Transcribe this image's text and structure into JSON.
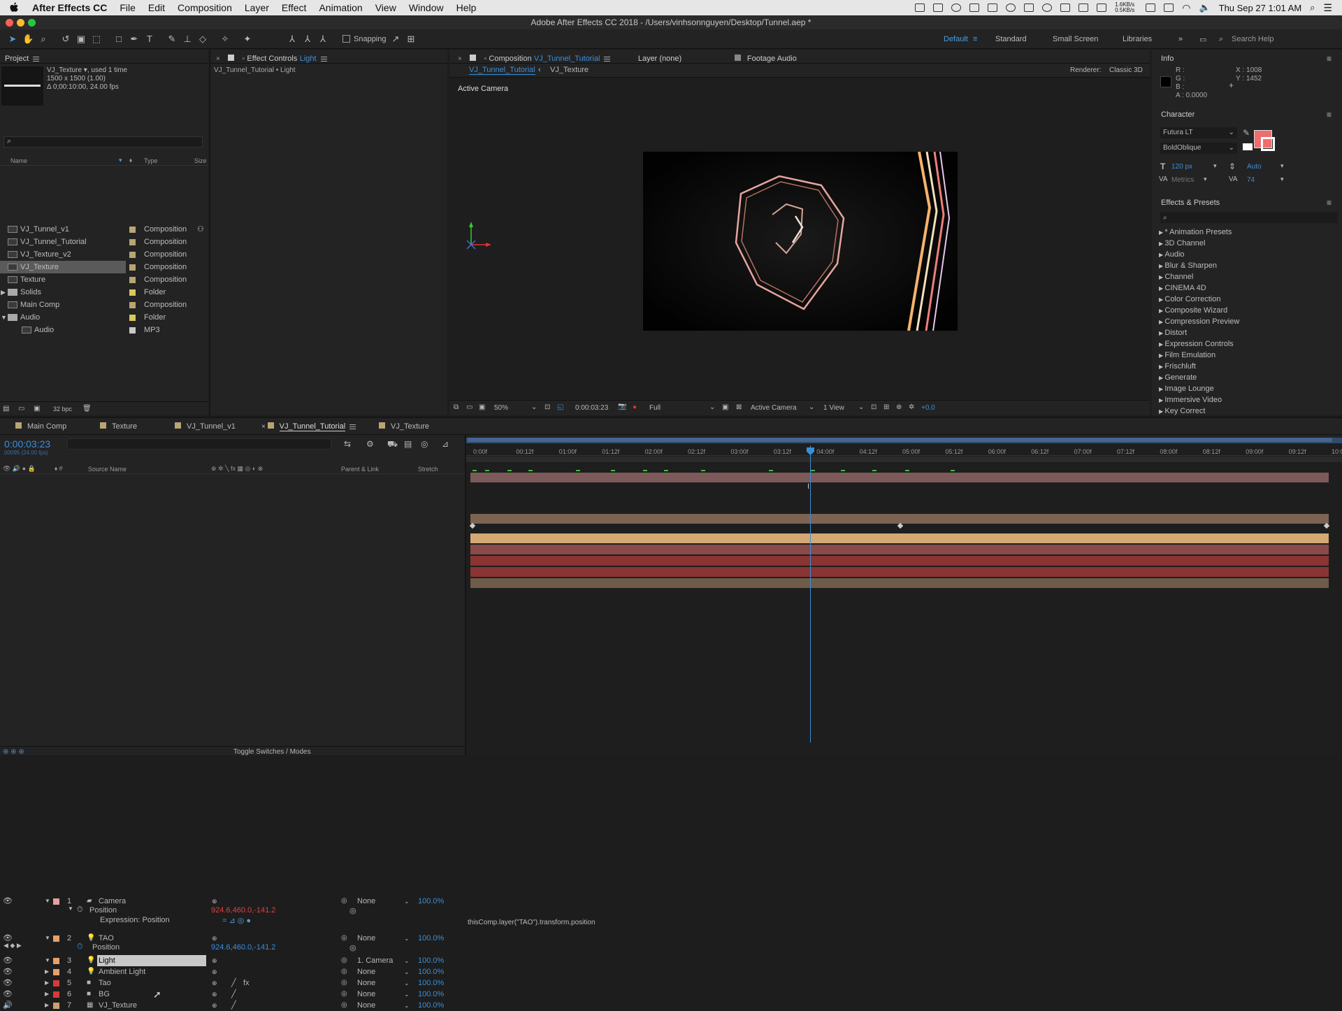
{
  "menubar": {
    "app": "After Effects CC",
    "items": [
      "File",
      "Edit",
      "Composition",
      "Layer",
      "Effect",
      "Animation",
      "View",
      "Window",
      "Help"
    ],
    "net": "1.6KB/s\n0.5KB/s",
    "clock": "Thu Sep 27  1:01 AM"
  },
  "window_title": "Adobe After Effects CC 2018 - /Users/vinhsonnguyen/Desktop/Tunnel.aep *",
  "toolbar": {
    "snapping": "Snapping",
    "workspaces": [
      "Default",
      "Standard",
      "Small Screen",
      "Libraries"
    ],
    "search": "Search Help"
  },
  "project": {
    "tab": "Project",
    "selected_name": "VJ_Texture",
    "used": ", used 1 time",
    "dims": "1500 x 1500 (1.00)",
    "duration": "Δ 0;00:10:00, 24.00 fps",
    "col_name": "Name",
    "col_type": "Type",
    "col_size": "Size",
    "bpc": "32 bpc",
    "items": [
      {
        "name": "VJ_Tunnel_v1",
        "type": "Composition",
        "color": "#b9a473"
      },
      {
        "name": "VJ_Tunnel_Tutorial",
        "type": "Composition",
        "color": "#b9a473"
      },
      {
        "name": "VJ_Texture_v2",
        "type": "Composition",
        "color": "#b9a473"
      },
      {
        "name": "VJ_Texture",
        "type": "Composition",
        "color": "#b9a473"
      },
      {
        "name": "Texture",
        "type": "Composition",
        "color": "#b9a473"
      },
      {
        "name": "Solids",
        "type": "Folder",
        "color": "#d9c85a"
      },
      {
        "name": "Main Comp",
        "type": "Composition",
        "color": "#b9a473"
      },
      {
        "name": "Audio",
        "type": "Folder",
        "color": "#d9c85a"
      },
      {
        "name": "Audio",
        "type": "MP3",
        "color": "#c9c9c9"
      }
    ]
  },
  "effect_controls": {
    "tab": "Effect Controls",
    "layer": "Light",
    "sub": "VJ_Tunnel_Tutorial • Light"
  },
  "comp": {
    "tab_prefix": "Composition",
    "tab_name": "VJ_Tunnel_Tutorial",
    "layer_tab": "Layer (none)",
    "footage_tab": "Footage Audio",
    "crumb1": "VJ_Tunnel_Tutorial",
    "crumb2": "VJ_Texture",
    "renderer_label": "Renderer:",
    "renderer": "Classic 3D",
    "view_label": "Active Camera",
    "zoom": "50%",
    "timecode": "0:00:03:23",
    "quality": "Full",
    "camera": "Active Camera",
    "views": "1 View",
    "exposure": "+0.0"
  },
  "info": {
    "tab": "Info",
    "r": "R :",
    "g": "G :",
    "b": "B :",
    "a": "A :  0.0000",
    "x": "X : 1008",
    "y": "Y : 1452"
  },
  "character": {
    "tab": "Character",
    "font": "Futura LT",
    "style": "BoldOblique",
    "size": "120 px",
    "leading": "Auto",
    "kerning": "Metrics",
    "tracking": "74"
  },
  "effects": {
    "tab": "Effects & Presets",
    "items": [
      "* Animation Presets",
      "3D Channel",
      "Audio",
      "Blur & Sharpen",
      "Channel",
      "CINEMA 4D",
      "Color Correction",
      "Composite Wizard",
      "Compression Preview",
      "Distort",
      "Expression Controls",
      "Film Emulation",
      "Frischluft",
      "Generate",
      "Image Lounge",
      "Immersive Video",
      "Key Correct"
    ]
  },
  "timeline": {
    "tabs": [
      "Main Comp",
      "Texture",
      "VJ_Tunnel_v1",
      "VJ_Tunnel_Tutorial",
      "VJ_Texture"
    ],
    "timecode": "0:00:03:23",
    "frames": "00095 (24.00 fps)",
    "col_source": "Source Name",
    "col_parent": "Parent & Link",
    "col_stretch": "Stretch",
    "toggle": "Toggle Switches / Modes",
    "ruler": [
      "0:00f",
      "00:12f",
      "01:00f",
      "01:12f",
      "02:00f",
      "02:12f",
      "03:00f",
      "03:12f",
      "04:00f",
      "04:12f",
      "05:00f",
      "05:12f",
      "06:00f",
      "06:12f",
      "07:00f",
      "07:12f",
      "08:00f",
      "08:12f",
      "09:00f",
      "09:12f",
      "10:0"
    ],
    "layers": [
      {
        "num": "1",
        "name": "Camera",
        "parent": "None",
        "stretch": "100.0%"
      },
      {
        "num": "2",
        "name": "TAO",
        "parent": "None",
        "stretch": "100.0%"
      },
      {
        "num": "3",
        "name": "Light",
        "parent": "1. Camera",
        "stretch": "100.0%"
      },
      {
        "num": "4",
        "name": "Ambient Light",
        "parent": "None",
        "stretch": "100.0%"
      },
      {
        "num": "5",
        "name": "Tao",
        "parent": "None",
        "stretch": "100.0%"
      },
      {
        "num": "6",
        "name": "BG",
        "parent": "None",
        "stretch": "100.0%"
      },
      {
        "num": "7",
        "name": "VJ_Texture",
        "parent": "None",
        "stretch": "100.0%"
      }
    ],
    "position_label": "Position",
    "position_value": "924.6,460.0,-141.2",
    "expr_label": "Expression: Position",
    "expr_text": "thisComp.layer(\"TAO\").transform.position"
  }
}
